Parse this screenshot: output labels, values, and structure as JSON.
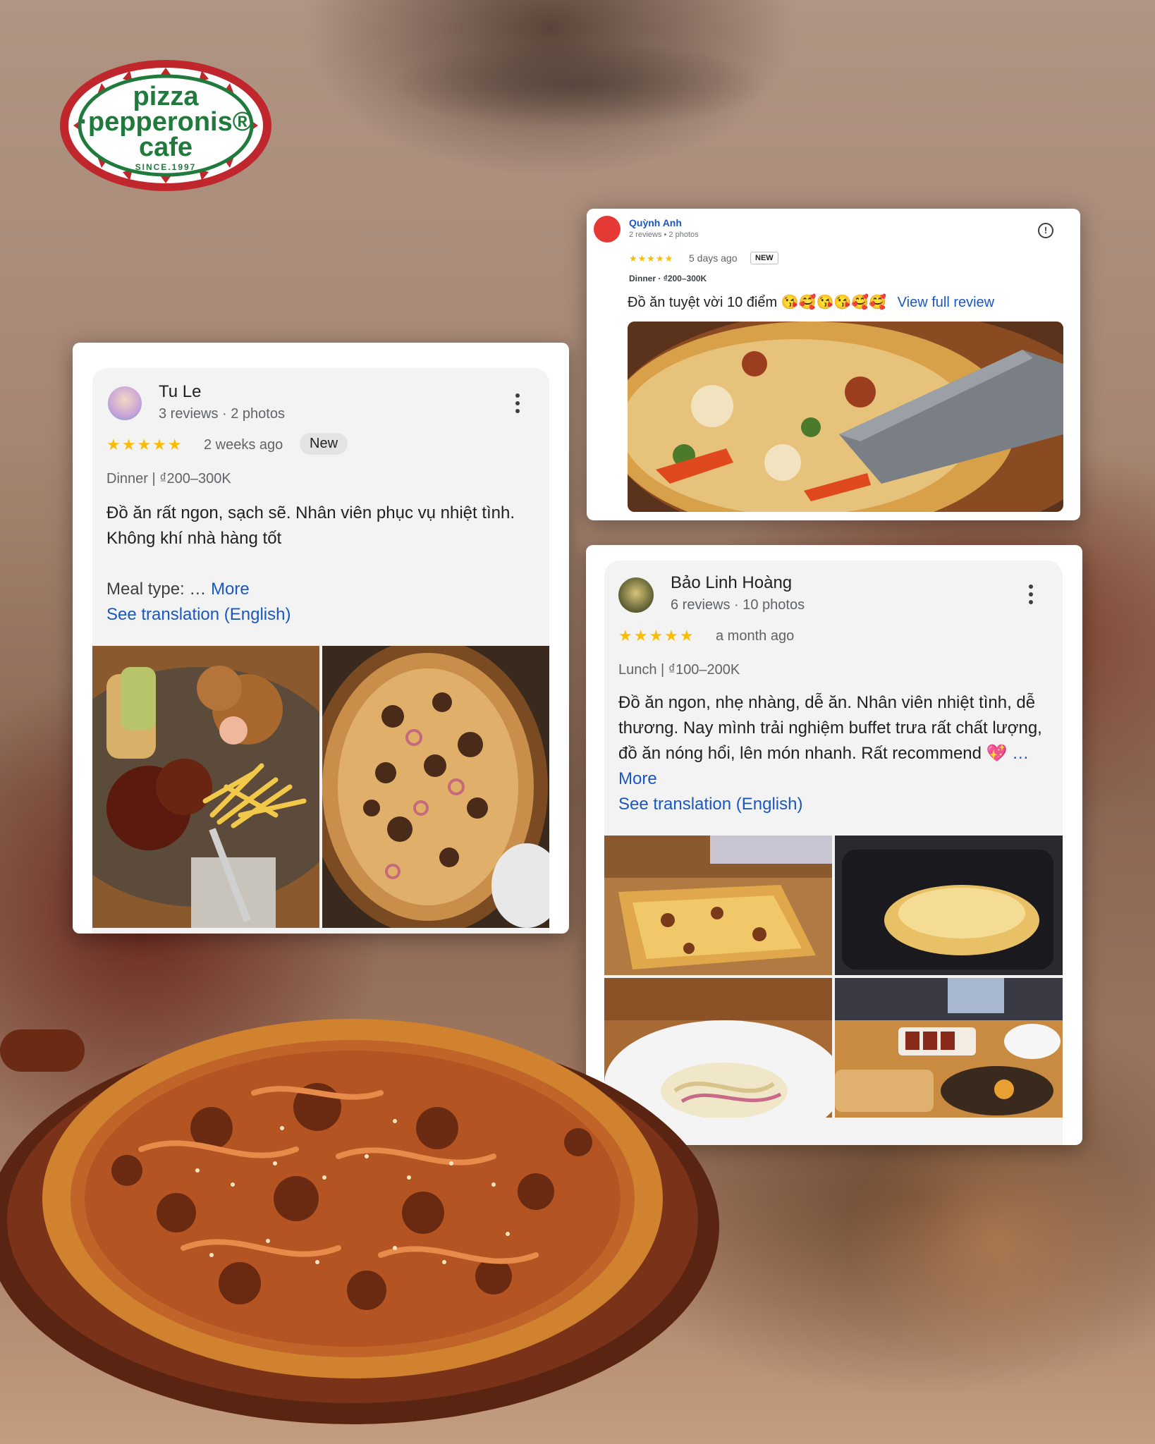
{
  "logo": {
    "line1": "pizza",
    "line2": "·pepperonis®",
    "line3": "cafe",
    "line4": "SINCE.1997"
  },
  "review_quynh": {
    "name": "Quỳnh Anh",
    "meta": "2 reviews • 2 photos",
    "stars": "★★★★★",
    "ago": "5 days ago",
    "badge": "NEW",
    "meal": "Dinner · ₫200–300K",
    "text": "Đồ ăn tuyệt vời 10 điểm 😘🥰😘😘🥰🥰",
    "link": "View full review",
    "info_icon": "info-icon"
  },
  "review_tule": {
    "name": "Tu Le",
    "meta": "3 reviews · 2 photos",
    "stars": "★★★★★",
    "ago": "2 weeks ago",
    "badge": "New",
    "meal": "Dinner  |  ₫200–300K",
    "text": "Đồ ăn rất ngon, sạch sẽ. Nhân viên phục vụ nhiệt tình. Không khí nhà hàng tốt",
    "meal_type": "Meal type: … ",
    "more": "More",
    "translation": "See translation (English)"
  },
  "review_baolinh": {
    "name": "Bảo Linh Hoàng",
    "meta": "6 reviews · 10 photos",
    "stars": "★★★★★",
    "ago": "a month ago",
    "meal": "Lunch  |  ₫100–200K",
    "text": "Đồ ăn ngon, nhẹ nhàng, dễ ăn. Nhân viên nhiệt tình, dễ thương. Nay mình trải nghiệm buffet trưa rất chất lượng, đồ ăn nóng hổi, lên món nhanh. Rất recommend 💖 ",
    "more": "… More",
    "translation": "See translation (English)"
  },
  "colors": {
    "star": "#fbbc04",
    "link": "#1a57c0",
    "logo_green": "#1f7a3c",
    "logo_red": "#c0272d"
  }
}
